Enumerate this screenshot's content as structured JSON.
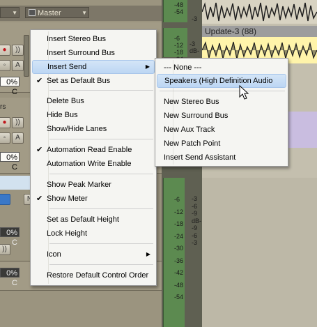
{
  "header": {
    "master_label": "Master"
  },
  "strips": {
    "pct_1": "0% C",
    "pct_2": "0% C",
    "pct_3": "0% C",
    "pct_4": "0% C",
    "stub_a": "A",
    "stub_rs": "rs",
    "stub_n": "N"
  },
  "meter": {
    "top_scale": [
      "-48",
      "-54"
    ],
    "top_scale_r": [
      "-3"
    ],
    "mid_scale": [
      "-6",
      "-12",
      "-18",
      "-24"
    ],
    "mid_scale_r": [
      "-3",
      "dB-"
    ],
    "bottom_scale_l": [
      "-6",
      "-12",
      "-18",
      "-24",
      "-30",
      "-36",
      "-42",
      "-48",
      "-54"
    ],
    "bottom_scale_r": [
      "-3",
      "-6",
      "-9",
      "dB-",
      "-9",
      "-6",
      "-3"
    ]
  },
  "tracks": {
    "clip_name": "Update-3 (88)"
  },
  "context_menu": {
    "items": [
      {
        "label": "Insert Stereo Bus",
        "checked": false
      },
      {
        "label": "Insert Surround Bus",
        "checked": false
      },
      {
        "label": "Insert Send",
        "checked": false,
        "submenu": true
      },
      {
        "label": "Set as Default Bus",
        "checked": true
      },
      {
        "label": "Delete Bus",
        "checked": false
      },
      {
        "label": "Hide Bus",
        "checked": false
      },
      {
        "label": "Show/Hide Lanes",
        "checked": false
      },
      {
        "label": "Automation Read Enable",
        "checked": true
      },
      {
        "label": "Automation Write Enable",
        "checked": false
      },
      {
        "label": "Show Peak Marker",
        "checked": false
      },
      {
        "label": "Show Meter",
        "checked": true
      },
      {
        "label": "Set as Default Height",
        "checked": false
      },
      {
        "label": "Lock Height",
        "checked": false
      },
      {
        "label": "Icon",
        "checked": false,
        "submenu": true
      },
      {
        "label": "Restore Default Control Order",
        "checked": false
      }
    ]
  },
  "send_submenu": {
    "items": [
      {
        "label": "--- None ---"
      },
      {
        "label": "Speakers (High Definition Audio"
      },
      {
        "label": "New Stereo Bus"
      },
      {
        "label": "New Surround Bus"
      },
      {
        "label": "New Aux Track"
      },
      {
        "label": "New Patch Point"
      },
      {
        "label": "Insert Send Assistant"
      }
    ]
  },
  "colors": {
    "highlight": "#c7ddf5",
    "clip_fill": "#fff4aa",
    "purple_clip": "#c9bde0"
  }
}
